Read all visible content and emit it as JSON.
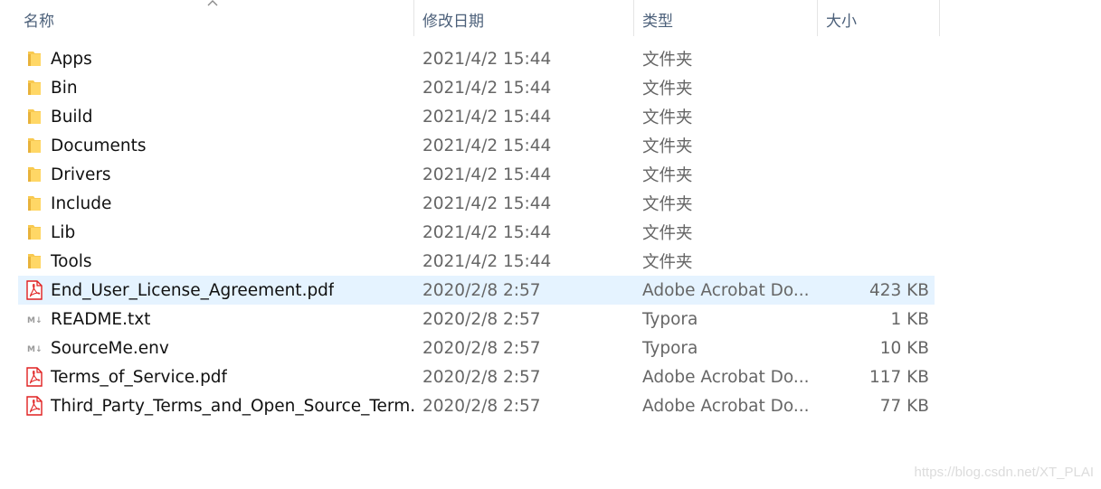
{
  "columns": {
    "name": "名称",
    "date": "修改日期",
    "type": "类型",
    "size": "大小"
  },
  "sort": {
    "column": "name",
    "direction": "ascending",
    "icon": "chevron-up-icon"
  },
  "files": [
    {
      "name": "Apps",
      "date": "2021/4/2 15:44",
      "type": "文件夹",
      "size": "",
      "icon": "folder-icon"
    },
    {
      "name": "Bin",
      "date": "2021/4/2 15:44",
      "type": "文件夹",
      "size": "",
      "icon": "folder-icon"
    },
    {
      "name": "Build",
      "date": "2021/4/2 15:44",
      "type": "文件夹",
      "size": "",
      "icon": "folder-icon"
    },
    {
      "name": "Documents",
      "date": "2021/4/2 15:44",
      "type": "文件夹",
      "size": "",
      "icon": "folder-icon"
    },
    {
      "name": "Drivers",
      "date": "2021/4/2 15:44",
      "type": "文件夹",
      "size": "",
      "icon": "folder-icon"
    },
    {
      "name": "Include",
      "date": "2021/4/2 15:44",
      "type": "文件夹",
      "size": "",
      "icon": "folder-icon"
    },
    {
      "name": "Lib",
      "date": "2021/4/2 15:44",
      "type": "文件夹",
      "size": "",
      "icon": "folder-icon"
    },
    {
      "name": "Tools",
      "date": "2021/4/2 15:44",
      "type": "文件夹",
      "size": "",
      "icon": "folder-icon"
    },
    {
      "name": "End_User_License_Agreement.pdf",
      "date": "2020/2/8 2:57",
      "type": "Adobe Acrobat Do...",
      "size": "423 KB",
      "icon": "pdf-icon",
      "selected": true
    },
    {
      "name": "README.txt",
      "date": "2020/2/8 2:57",
      "type": "Typora",
      "size": "1 KB",
      "icon": "markdown-icon"
    },
    {
      "name": "SourceMe.env",
      "date": "2020/2/8 2:57",
      "type": "Typora",
      "size": "10 KB",
      "icon": "markdown-icon"
    },
    {
      "name": "Terms_of_Service.pdf",
      "date": "2020/2/8 2:57",
      "type": "Adobe Acrobat Do...",
      "size": "117 KB",
      "icon": "pdf-icon"
    },
    {
      "name": "Third_Party_Terms_and_Open_Source_Term...",
      "date": "2020/2/8 2:57",
      "type": "Adobe Acrobat Do...",
      "size": "77 KB",
      "icon": "pdf-icon"
    }
  ],
  "colors": {
    "header_text": "#4c607a",
    "selected_row": "#e5f3ff",
    "folder": "#f8c950",
    "pdf": "#e02020"
  },
  "watermark": "https://blog.csdn.net/XT_PLAI"
}
